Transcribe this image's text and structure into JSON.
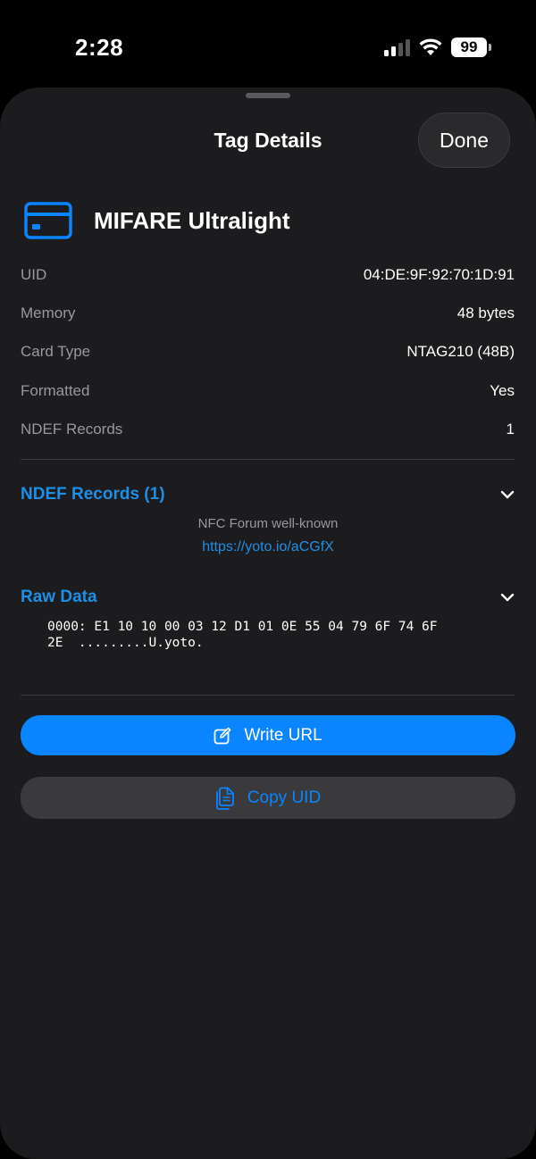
{
  "status_bar": {
    "time": "2:28",
    "battery": "99",
    "icons": [
      "signal-icon",
      "wifi-icon",
      "battery-icon"
    ]
  },
  "sheet": {
    "title": "Tag Details",
    "done_label": "Done"
  },
  "tag": {
    "name": "MIFARE Ultralight",
    "icon": "card-icon",
    "rows": [
      {
        "label": "UID",
        "value": "04:DE:9F:92:70:1D:91"
      },
      {
        "label": "Memory",
        "value": "48 bytes"
      },
      {
        "label": "Card Type",
        "value": "NTAG210 (48B)"
      },
      {
        "label": "Formatted",
        "value": "Yes"
      },
      {
        "label": "NDEF Records",
        "value": "1"
      }
    ]
  },
  "ndef_section": {
    "title": "NDEF Records (1)",
    "record_type": "NFC Forum well-known",
    "record_url": "https://yoto.io/aCGfX"
  },
  "raw_section": {
    "title": "Raw Data",
    "lines": [
      "0000: E1 10 10 00 03 12 D1 01 0E 55 04 79 6F 74 6F",
      "2E  .........U.yoto."
    ]
  },
  "actions": {
    "write_url_label": "Write URL",
    "copy_uid_label": "Copy UID"
  },
  "colors": {
    "accent": "#0a84ff",
    "sheet_bg": "#1c1c1e",
    "secondary_button_bg": "#3a3a3c"
  }
}
